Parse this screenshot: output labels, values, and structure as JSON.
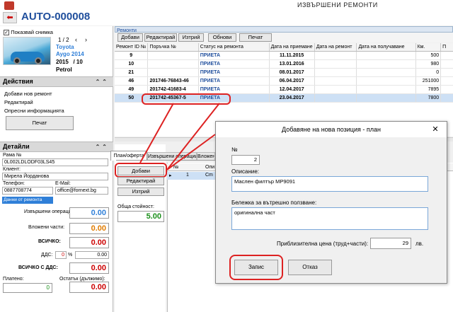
{
  "window": {
    "system_title": "ИЗВЪРШЕНИ РЕМОНТИ",
    "page_title": "AUTO-000008"
  },
  "left": {
    "show_photo_label": "Показвай снимка",
    "pager": "1 / 2",
    "car": {
      "make": "Toyota",
      "model": "Aygo 2014",
      "year_line": "2015   / 10",
      "fuel": "Petrol"
    },
    "actions": {
      "title": "Действия",
      "items": [
        "Добави нов ремонт",
        "Редактирай",
        "Опресни информацията"
      ],
      "print_button": "Печат"
    },
    "details": {
      "title": "Детайли",
      "vin_label": "Рама №",
      "vin_value": "0L002LDLODF03LS45",
      "client_label": "Клиент:",
      "client_value": "Мирела Йорданова",
      "phone_label": "Телефон:",
      "phone_value": "0887708774",
      "email_label": "E-Mail:",
      "email_value": "office@fornext.bg",
      "repair_data_band": "Данни от ремонта",
      "ops_label": "Извършени операции:",
      "ops_value": "0.00",
      "parts_label": "Вложени части:",
      "parts_value": "0.00",
      "total_label": "ВСИЧКО:",
      "total_value": "0.00",
      "vat_label": "ДДС:",
      "vat_percent": "0",
      "vat_percent_sign": "%",
      "vat_value": "0.00",
      "total_vat_label": "ВСИЧКО С ДДС:",
      "total_vat_value": "0.00",
      "paid_label": "Платено:",
      "paid_value": "0",
      "remaining_label": "Остатък (дължимо):",
      "remaining_value": "0.00"
    }
  },
  "repairs": {
    "band_title": "Ремонти",
    "toolbar": [
      "Добави",
      "Редактирай",
      "Изтрий",
      "Обнови",
      "Печат"
    ],
    "columns": [
      "Ремонт ID №",
      "Поръчка №",
      "Статус на ремонта",
      "Дата на приемане",
      "Дата на ремонт",
      "Дата на получаване",
      "Км.",
      "П"
    ],
    "rows": [
      {
        "id": "9",
        "order": "",
        "status": "ПРИЕТА",
        "received": "11.11.2015",
        "repair": "",
        "pickup": "",
        "km": "500"
      },
      {
        "id": "10",
        "order": "",
        "status": "ПРИЕТА",
        "received": "13.01.2016",
        "repair": "",
        "pickup": "",
        "km": "980"
      },
      {
        "id": "21",
        "order": "",
        "status": "ПРИЕТА",
        "received": "08.01.2017",
        "repair": "",
        "pickup": "",
        "km": "0"
      },
      {
        "id": "46",
        "order": "201746-76843-46",
        "status": "ПРИЕТА",
        "received": "06.04.2017",
        "repair": "",
        "pickup": "",
        "km": "251000"
      },
      {
        "id": "49",
        "order": "201742-41683-4",
        "status": "ПРИЕТА",
        "received": "12.04.2017",
        "repair": "",
        "pickup": "",
        "km": "7895"
      },
      {
        "id": "50",
        "order": "201742-45367-5",
        "status": "ПРИЕТА",
        "received": "23.04.2017",
        "repair": "",
        "pickup": "",
        "km": "7800"
      }
    ]
  },
  "plan": {
    "tabs": [
      "План/оферта",
      "Извършени операции",
      "Вложени"
    ],
    "buttons": [
      "Добави",
      "Редактирай",
      "Изтрий"
    ],
    "total_label": "Обща стойност:",
    "total_value": "5.00",
    "grid_columns": [
      "№",
      "Опи"
    ],
    "grid_row": {
      "no": "1",
      "desc": "Сm"
    }
  },
  "dialog": {
    "title": "Добавяне на нова позиция - план",
    "close": "✕",
    "no_label": "№",
    "no_value": "2",
    "desc_label": "Описание:",
    "desc_value": "Маслен филтър MP9091",
    "note_label": "Бележка за вътрешно ползване:",
    "note_value": "оригинална част",
    "price_label": "Приблизителна цена (труд+части):",
    "price_value": "29",
    "currency": "лв.",
    "save_button": "Запис",
    "cancel_button": "Отказ"
  },
  "colors": {
    "accent_blue": "#1f4e9c",
    "highlight_red": "#d22",
    "green_total": "#1a8f1a",
    "orange_value": "#e07b00",
    "blue_value": "#2f7fd8",
    "red_value": "#cc0000"
  }
}
